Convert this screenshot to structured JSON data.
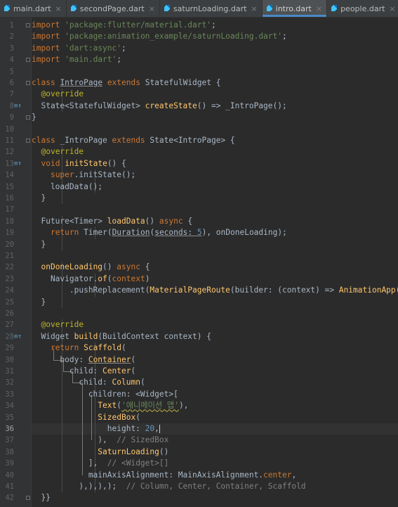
{
  "tabs": [
    {
      "label": "main.dart",
      "active": false
    },
    {
      "label": "secondPage.dart",
      "active": false
    },
    {
      "label": "saturnLoading.dart",
      "active": false
    },
    {
      "label": "intro.dart",
      "active": true
    },
    {
      "label": "people.dart",
      "active": false
    }
  ],
  "tab_icon": "dart-file-icon",
  "close_glyph": "×",
  "current_line": 36,
  "line_numbers": [
    "1",
    "2",
    "3",
    "4",
    "5",
    "6",
    "7",
    "8",
    "9",
    "10",
    "11",
    "12",
    "13",
    "14",
    "15",
    "16",
    "17",
    "18",
    "19",
    "20",
    "21",
    "22",
    "23",
    "24",
    "25",
    "26",
    "27",
    "28",
    "29",
    "30",
    "31",
    "32",
    "33",
    "34",
    "35",
    "36",
    "37",
    "38",
    "39",
    "40",
    "41",
    "42"
  ],
  "code": {
    "l1": [
      "import",
      " ",
      "'package:flutter/material.dart'",
      ";"
    ],
    "l2": [
      "import",
      " ",
      "'package:animation_example/saturnLoading.dart'",
      ";"
    ],
    "l3": [
      "import",
      " ",
      "'dart:async'",
      ";"
    ],
    "l4": [
      "import",
      " ",
      "'main.dart'",
      ";"
    ],
    "l6": [
      "class",
      " ",
      "IntroPage",
      " ",
      "extends",
      " StatefulWidget {"
    ],
    "l7": [
      "  ",
      "@override"
    ],
    "l8": [
      "  State<StatefulWidget> ",
      "createState",
      "() => _IntroPage()",
      ";"
    ],
    "l9": [
      "}"
    ],
    "l11": [
      "class",
      " _IntroPage ",
      "extends",
      " State<IntroPage> {"
    ],
    "l12": [
      "  ",
      "@override"
    ],
    "l13": [
      "  ",
      "void",
      " ",
      "initState",
      "() {"
    ],
    "l14": [
      "    ",
      "super",
      ".initState()",
      ";"
    ],
    "l15": [
      "    loadData()",
      ";"
    ],
    "l16": [
      "  }"
    ],
    "l18": [
      "  Future<Timer> ",
      "loadData",
      "() ",
      "async",
      " {"
    ],
    "l19": [
      "    ",
      "return",
      " ",
      "Timer",
      "(",
      "Duration",
      "(",
      "seconds: ",
      "5",
      ")",
      ", onDoneLoading)",
      ";"
    ],
    "l20": [
      "  }"
    ],
    "l22": [
      "  ",
      "onDoneLoading",
      "() ",
      "async",
      " {"
    ],
    "l23": [
      "    Navigator.",
      "of",
      "(",
      "context",
      ")"
    ],
    "l24": [
      "        .pushReplacement(",
      "MaterialPageRoute",
      "(builder: (context) => ",
      "AnimationApp",
      "()))",
      ";"
    ],
    "l25": [
      "  }"
    ],
    "l27": [
      "  ",
      "@override"
    ],
    "l28": [
      "  Widget ",
      "build",
      "(BuildContext context) {"
    ],
    "l29": [
      "    ",
      "return",
      " ",
      "Scaffold",
      "("
    ],
    "l30": [
      "      body: ",
      "Container",
      "("
    ],
    "l31": [
      "        child: ",
      "Center",
      "("
    ],
    "l32": [
      "          child: ",
      "Column",
      "("
    ],
    "l33": [
      "            children: <Widget>["
    ],
    "l34": [
      "              ",
      "Text",
      "(",
      "'애니메이션 앱'",
      "),"
    ],
    "l35": [
      "              ",
      "SizedBox",
      "("
    ],
    "l36": [
      "                height: ",
      "20",
      ","
    ],
    "l37": [
      "              ),  ",
      "// SizedBox"
    ],
    "l38": [
      "              ",
      "SaturnLoading",
      "()"
    ],
    "l39": [
      "            ],  ",
      "// <Widget>[]"
    ],
    "l40": [
      "            mainAxisAlignment: MainAxisAlignment.",
      "center",
      ","
    ],
    "l41": [
      "          ),),),);  ",
      "// Column, Center, Container, Scaffold"
    ],
    "l42": [
      "  }}"
    ]
  },
  "gutter_markers": [
    {
      "line": 8,
      "icon": "override-marker-icon",
      "glyph": "⊙↑"
    },
    {
      "line": 13,
      "icon": "override-marker-icon",
      "glyph": "⊙↑"
    },
    {
      "line": 28,
      "icon": "override-marker-icon",
      "glyph": "⊙↑"
    }
  ],
  "colors": {
    "background": "#2b2b2b",
    "keyword": "#cc7832",
    "string": "#6a8759",
    "annotation": "#bbb529",
    "function": "#ffc66d",
    "comment": "#808080",
    "number": "#6897bb",
    "text": "#a9b7c6",
    "tab_active_underline": "#4a88c7"
  }
}
